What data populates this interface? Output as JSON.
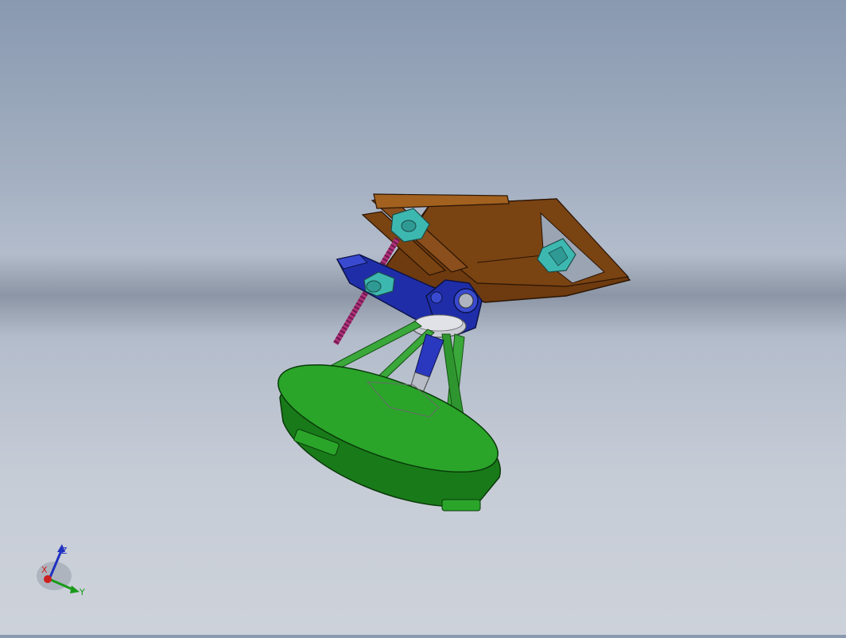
{
  "viewport": {
    "colors": {
      "frame": "#6e3a0f",
      "frame_light": "#8a4f1c",
      "base": "#2aa52a",
      "base_dark": "#197a19",
      "strut": "#3aa83a",
      "bracket": "#1f2ea8",
      "bracket_light": "#3a4ad0",
      "bearing": "#3db8b0",
      "screw": "#b0307a",
      "rod": "#9aa0aa"
    },
    "triad": {
      "x_label": "X",
      "y_label": "Y",
      "z_label": "Z",
      "x_color": "#cc2020",
      "y_color": "#1a9a1a",
      "z_color": "#2030c0"
    }
  }
}
